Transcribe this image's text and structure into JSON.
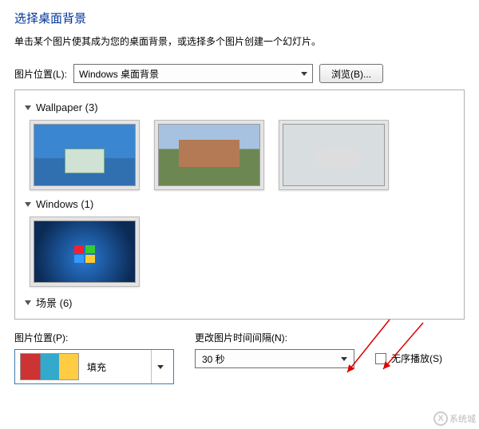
{
  "header": {
    "title": "选择桌面背景",
    "subtitle": "单击某个图片使其成为您的桌面背景，或选择多个图片创建一个幻灯片。"
  },
  "location": {
    "label": "图片位置(L):",
    "value": "Windows 桌面背景",
    "browse": "浏览(B)..."
  },
  "groups": {
    "wallpaper": {
      "label": "Wallpaper (3)"
    },
    "windows": {
      "label": "Windows (1)"
    },
    "scenes": {
      "label": "场景 (6)"
    }
  },
  "fit": {
    "label": "图片位置(P):",
    "value": "填充"
  },
  "interval": {
    "label": "更改图片时间间隔(N):",
    "value": "30 秒"
  },
  "shuffle": {
    "label": "无序播放(S)"
  },
  "watermark": "系统城"
}
